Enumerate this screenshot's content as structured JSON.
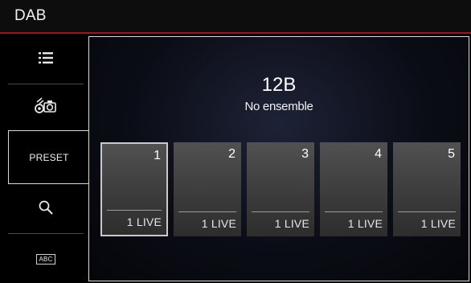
{
  "header": {
    "title": "DAB"
  },
  "sidebar": {
    "items": [
      {
        "icon": "list-icon"
      },
      {
        "icon": "dab-scan-icon"
      },
      {
        "label": "PRESET",
        "active": true
      },
      {
        "icon": "search-icon"
      },
      {
        "icon": "abc-icon",
        "label": "ABC"
      }
    ]
  },
  "main": {
    "frequency": "12B",
    "ensemble": "No ensemble",
    "presets": [
      {
        "number": "1",
        "station": "1 LIVE",
        "selected": true
      },
      {
        "number": "2",
        "station": "1 LIVE",
        "selected": false
      },
      {
        "number": "3",
        "station": "1 LIVE",
        "selected": false
      },
      {
        "number": "4",
        "station": "1 LIVE",
        "selected": false
      },
      {
        "number": "5",
        "station": "1 LIVE",
        "selected": false
      }
    ]
  },
  "colors": {
    "accent": "#a3121e",
    "background": "#000000"
  }
}
